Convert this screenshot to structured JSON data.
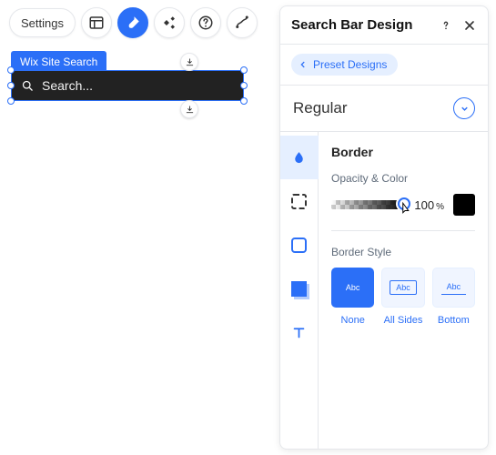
{
  "toolbar": {
    "settings_label": "Settings"
  },
  "element": {
    "tag_label": "Wix Site Search",
    "placeholder": "Search..."
  },
  "panel": {
    "title": "Search Bar Design",
    "breadcrumb": "Preset Designs",
    "state": "Regular",
    "section_title": "Border",
    "opacity_label": "Opacity & Color",
    "opacity_value": "100",
    "opacity_unit": "%",
    "swatch_color": "#000000",
    "border_style_label": "Border Style",
    "sample_text": "Abc",
    "styles": {
      "none": "None",
      "all": "All Sides",
      "bottom": "Bottom"
    }
  }
}
